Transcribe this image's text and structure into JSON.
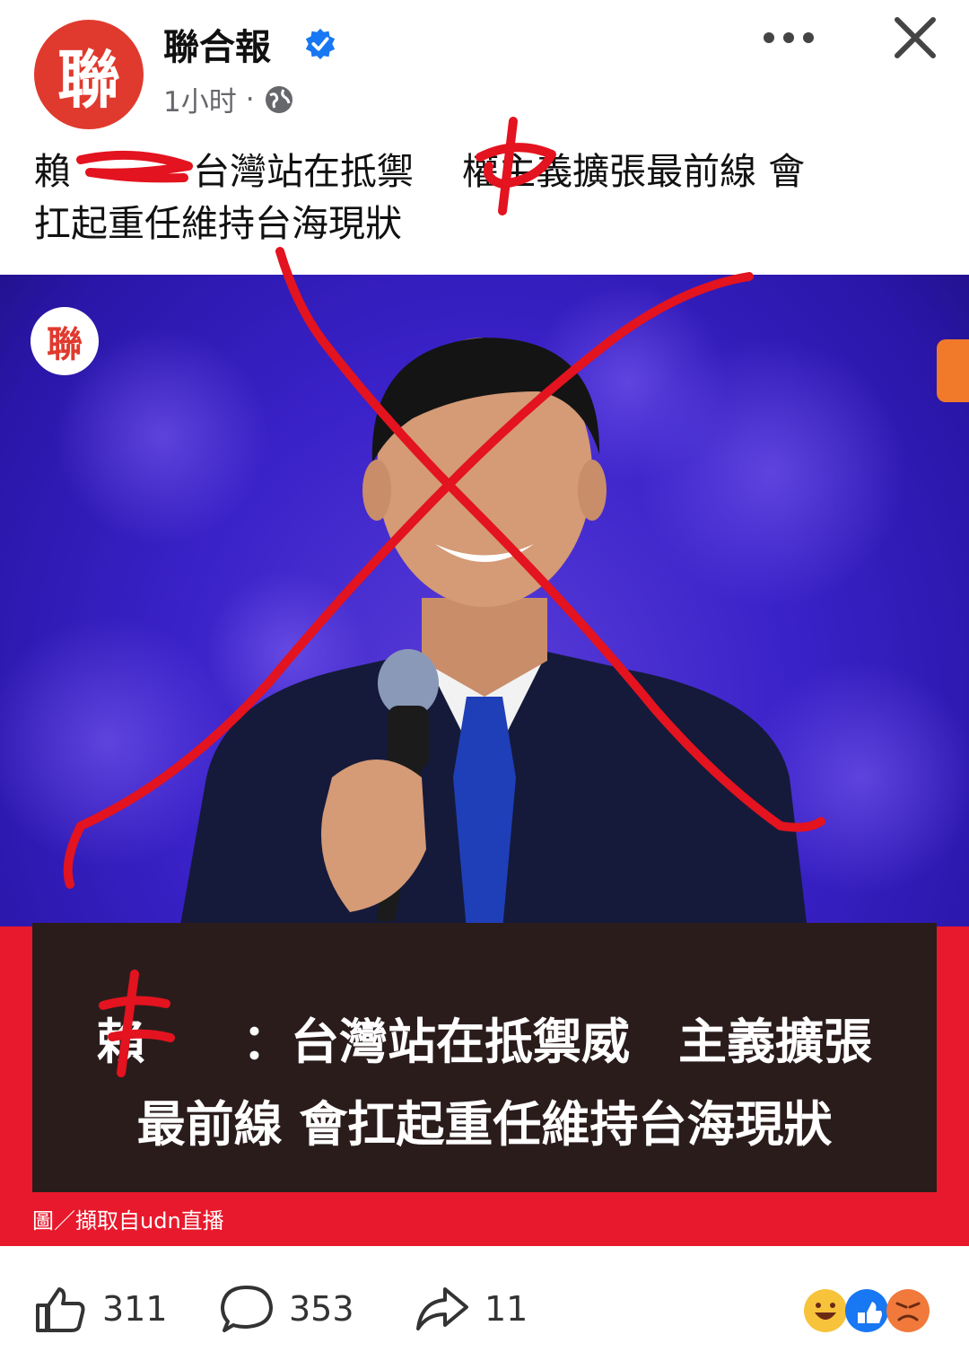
{
  "header": {
    "page_name": "聯合報",
    "avatar_glyph": "聯",
    "time": "1小时",
    "dot": "·"
  },
  "post": {
    "title_line_1": "賴　　　 台灣站在抵禦　 權主義擴張最前線 會",
    "title_line_2": "扛起重任維持台海現狀"
  },
  "image": {
    "watermark_glyph": "聯",
    "caption_line_1": "賴　　：台灣站在抵禦威　主義擴張",
    "caption_line_2": "最前線 會扛起重任維持台海現狀",
    "credit": "圖／擷取自udn直播"
  },
  "footer": {
    "like_count": "311",
    "comment_count": "353",
    "share_count": "11"
  },
  "colors": {
    "brand_red": "#e03a2e",
    "verified_blue": "#1877f2",
    "scribble_red": "#e3131f",
    "band_red": "#e8192c",
    "background_blue": "#3a22c9"
  },
  "icons": [
    "verified-badge-icon",
    "globe-icon",
    "more-icon",
    "close-icon",
    "like-icon",
    "comment-icon",
    "share-icon",
    "reaction-icons"
  ]
}
